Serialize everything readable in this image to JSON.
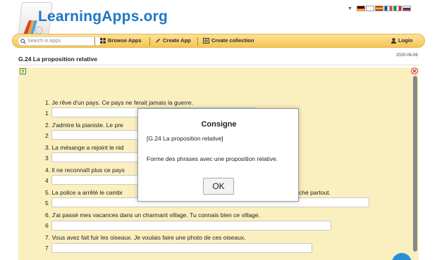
{
  "header": {
    "logo_text": "LearningApps.org",
    "language_flags": [
      {
        "name": "de-flag",
        "colors": [
          "#000000",
          "#dd0000",
          "#ffce00"
        ]
      },
      {
        "name": "uk-flag",
        "colors": [
          "#00247d",
          "#cf142b",
          "#ffffff"
        ]
      },
      {
        "name": "es-flag",
        "colors": [
          "#aa151b",
          "#f1bf00",
          "#aa151b"
        ]
      },
      {
        "name": "fr-flag",
        "colors": [
          "#0055a4",
          "#ffffff",
          "#ef4135"
        ]
      },
      {
        "name": "it-flag",
        "colors": [
          "#009246",
          "#ffffff",
          "#ce2b37"
        ]
      },
      {
        "name": "ru-flag",
        "colors": [
          "#ffffff",
          "#0039a6",
          "#d52b1e"
        ]
      }
    ]
  },
  "navbar": {
    "search_placeholder": "Search in Apps",
    "browse_label": "Browse Apps",
    "create_label": "Create App",
    "collection_label": "Create collection",
    "login_label": "Login"
  },
  "page": {
    "date": "2020-06-06",
    "title": "G.24 La proposition relative"
  },
  "exercise": {
    "items": [
      {
        "question": "1. Je rêve d'un pays. Ce pays ne ferait jamais la guerre.",
        "num": "1"
      },
      {
        "question": "2. J'admire la pianiste. Le pre",
        "num": "2"
      },
      {
        "question": "3. La mésange a rejoint le nid",
        "num": "3"
      },
      {
        "question": "4. Il ne reconnaît plus ce pays",
        "num": "4"
      },
      {
        "question": "5. La police a arrêté le cambr",
        "question_tail": "ché partout.",
        "num": "5"
      },
      {
        "question": "6. J'ai passé mes vacances dans un charmant village. Tu connais bien ce village.",
        "num": "6"
      },
      {
        "question": "7. Vous avez fait fuir les oiseaux. Je voulais faire une photo de ces oiseaux.",
        "num": "7"
      }
    ]
  },
  "dialog": {
    "title": "Consigne",
    "subtitle": "[G.24 La proposition relative]",
    "text": "Forme des phrases avec une proposition relative.",
    "ok_label": "OK"
  },
  "colors": {
    "accent_blue": "#1f77c4",
    "navbar_yellow": "#f3c654",
    "app_background": "#faefbe"
  }
}
